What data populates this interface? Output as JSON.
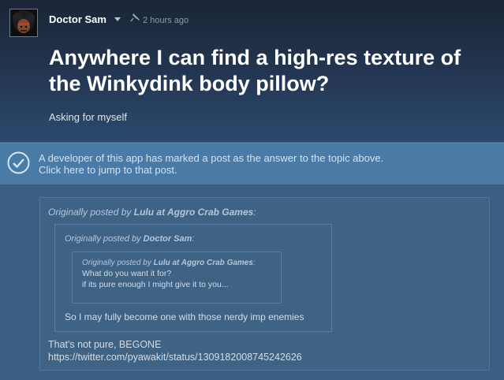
{
  "author": {
    "name": "Doctor Sam",
    "timestamp": "2 hours ago"
  },
  "topic": {
    "title": "Anywhere I can find a high-res texture of the Winkydink body pillow?",
    "body": "Asking for myself"
  },
  "answer_banner": {
    "line1": "A developer of this app has marked a post as the answer to the topic above.",
    "line2": "Click here to jump to that post."
  },
  "post": {
    "quote_outer": {
      "prefix": "Originally posted by ",
      "author": "Lulu at Aggro Crab Games",
      "suffix": ":"
    },
    "quote_middle": {
      "prefix": "Originally posted by ",
      "author": "Doctor Sam",
      "suffix": ":",
      "text": "So I may fully become one with those nerdy imp enemies"
    },
    "quote_inner": {
      "prefix": "Originally posted by ",
      "author": "Lulu at Aggro Crab Games",
      "suffix": ":",
      "line1": "What do you want it for?",
      "line2": "if its pure enough I might give it to you..."
    },
    "reply_line1": "That's not pure, BEGONE",
    "reply_link": "https://twitter.com/pyawakit/status/1309182008745242626"
  },
  "icons": {
    "avatar": "avatar-image",
    "caret": "chevron-down-icon",
    "pin": "pin-icon",
    "check": "check-circle-icon"
  },
  "colors": {
    "background": "#3a5f83",
    "banner": "#4a7ba6",
    "title_text": "#ffffff"
  }
}
